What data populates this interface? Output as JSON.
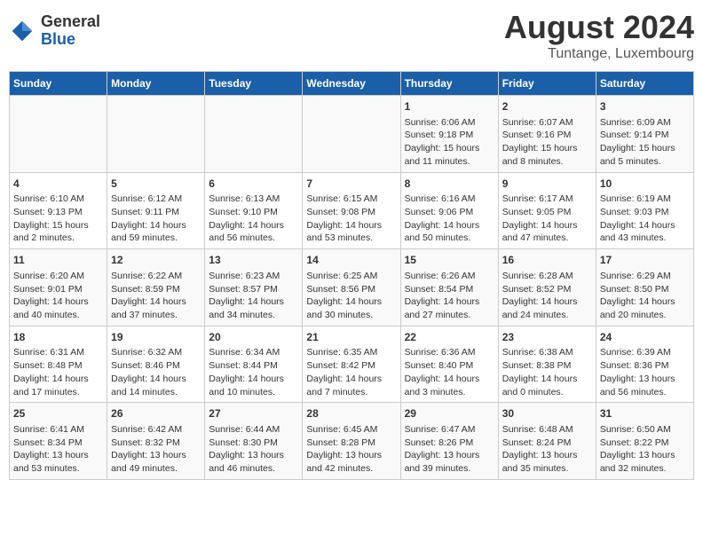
{
  "header": {
    "logo_general": "General",
    "logo_blue": "Blue",
    "month_title": "August 2024",
    "location": "Tuntange, Luxembourg"
  },
  "weekdays": [
    "Sunday",
    "Monday",
    "Tuesday",
    "Wednesday",
    "Thursday",
    "Friday",
    "Saturday"
  ],
  "weeks": [
    [
      {
        "day": "",
        "info": ""
      },
      {
        "day": "",
        "info": ""
      },
      {
        "day": "",
        "info": ""
      },
      {
        "day": "",
        "info": ""
      },
      {
        "day": "1",
        "info": "Sunrise: 6:06 AM\nSunset: 9:18 PM\nDaylight: 15 hours\nand 11 minutes."
      },
      {
        "day": "2",
        "info": "Sunrise: 6:07 AM\nSunset: 9:16 PM\nDaylight: 15 hours\nand 8 minutes."
      },
      {
        "day": "3",
        "info": "Sunrise: 6:09 AM\nSunset: 9:14 PM\nDaylight: 15 hours\nand 5 minutes."
      }
    ],
    [
      {
        "day": "4",
        "info": "Sunrise: 6:10 AM\nSunset: 9:13 PM\nDaylight: 15 hours\nand 2 minutes."
      },
      {
        "day": "5",
        "info": "Sunrise: 6:12 AM\nSunset: 9:11 PM\nDaylight: 14 hours\nand 59 minutes."
      },
      {
        "day": "6",
        "info": "Sunrise: 6:13 AM\nSunset: 9:10 PM\nDaylight: 14 hours\nand 56 minutes."
      },
      {
        "day": "7",
        "info": "Sunrise: 6:15 AM\nSunset: 9:08 PM\nDaylight: 14 hours\nand 53 minutes."
      },
      {
        "day": "8",
        "info": "Sunrise: 6:16 AM\nSunset: 9:06 PM\nDaylight: 14 hours\nand 50 minutes."
      },
      {
        "day": "9",
        "info": "Sunrise: 6:17 AM\nSunset: 9:05 PM\nDaylight: 14 hours\nand 47 minutes."
      },
      {
        "day": "10",
        "info": "Sunrise: 6:19 AM\nSunset: 9:03 PM\nDaylight: 14 hours\nand 43 minutes."
      }
    ],
    [
      {
        "day": "11",
        "info": "Sunrise: 6:20 AM\nSunset: 9:01 PM\nDaylight: 14 hours\nand 40 minutes."
      },
      {
        "day": "12",
        "info": "Sunrise: 6:22 AM\nSunset: 8:59 PM\nDaylight: 14 hours\nand 37 minutes."
      },
      {
        "day": "13",
        "info": "Sunrise: 6:23 AM\nSunset: 8:57 PM\nDaylight: 14 hours\nand 34 minutes."
      },
      {
        "day": "14",
        "info": "Sunrise: 6:25 AM\nSunset: 8:56 PM\nDaylight: 14 hours\nand 30 minutes."
      },
      {
        "day": "15",
        "info": "Sunrise: 6:26 AM\nSunset: 8:54 PM\nDaylight: 14 hours\nand 27 minutes."
      },
      {
        "day": "16",
        "info": "Sunrise: 6:28 AM\nSunset: 8:52 PM\nDaylight: 14 hours\nand 24 minutes."
      },
      {
        "day": "17",
        "info": "Sunrise: 6:29 AM\nSunset: 8:50 PM\nDaylight: 14 hours\nand 20 minutes."
      }
    ],
    [
      {
        "day": "18",
        "info": "Sunrise: 6:31 AM\nSunset: 8:48 PM\nDaylight: 14 hours\nand 17 minutes."
      },
      {
        "day": "19",
        "info": "Sunrise: 6:32 AM\nSunset: 8:46 PM\nDaylight: 14 hours\nand 14 minutes."
      },
      {
        "day": "20",
        "info": "Sunrise: 6:34 AM\nSunset: 8:44 PM\nDaylight: 14 hours\nand 10 minutes."
      },
      {
        "day": "21",
        "info": "Sunrise: 6:35 AM\nSunset: 8:42 PM\nDaylight: 14 hours\nand 7 minutes."
      },
      {
        "day": "22",
        "info": "Sunrise: 6:36 AM\nSunset: 8:40 PM\nDaylight: 14 hours\nand 3 minutes."
      },
      {
        "day": "23",
        "info": "Sunrise: 6:38 AM\nSunset: 8:38 PM\nDaylight: 14 hours\nand 0 minutes."
      },
      {
        "day": "24",
        "info": "Sunrise: 6:39 AM\nSunset: 8:36 PM\nDaylight: 13 hours\nand 56 minutes."
      }
    ],
    [
      {
        "day": "25",
        "info": "Sunrise: 6:41 AM\nSunset: 8:34 PM\nDaylight: 13 hours\nand 53 minutes."
      },
      {
        "day": "26",
        "info": "Sunrise: 6:42 AM\nSunset: 8:32 PM\nDaylight: 13 hours\nand 49 minutes."
      },
      {
        "day": "27",
        "info": "Sunrise: 6:44 AM\nSunset: 8:30 PM\nDaylight: 13 hours\nand 46 minutes."
      },
      {
        "day": "28",
        "info": "Sunrise: 6:45 AM\nSunset: 8:28 PM\nDaylight: 13 hours\nand 42 minutes."
      },
      {
        "day": "29",
        "info": "Sunrise: 6:47 AM\nSunset: 8:26 PM\nDaylight: 13 hours\nand 39 minutes."
      },
      {
        "day": "30",
        "info": "Sunrise: 6:48 AM\nSunset: 8:24 PM\nDaylight: 13 hours\nand 35 minutes."
      },
      {
        "day": "31",
        "info": "Sunrise: 6:50 AM\nSunset: 8:22 PM\nDaylight: 13 hours\nand 32 minutes."
      }
    ]
  ]
}
